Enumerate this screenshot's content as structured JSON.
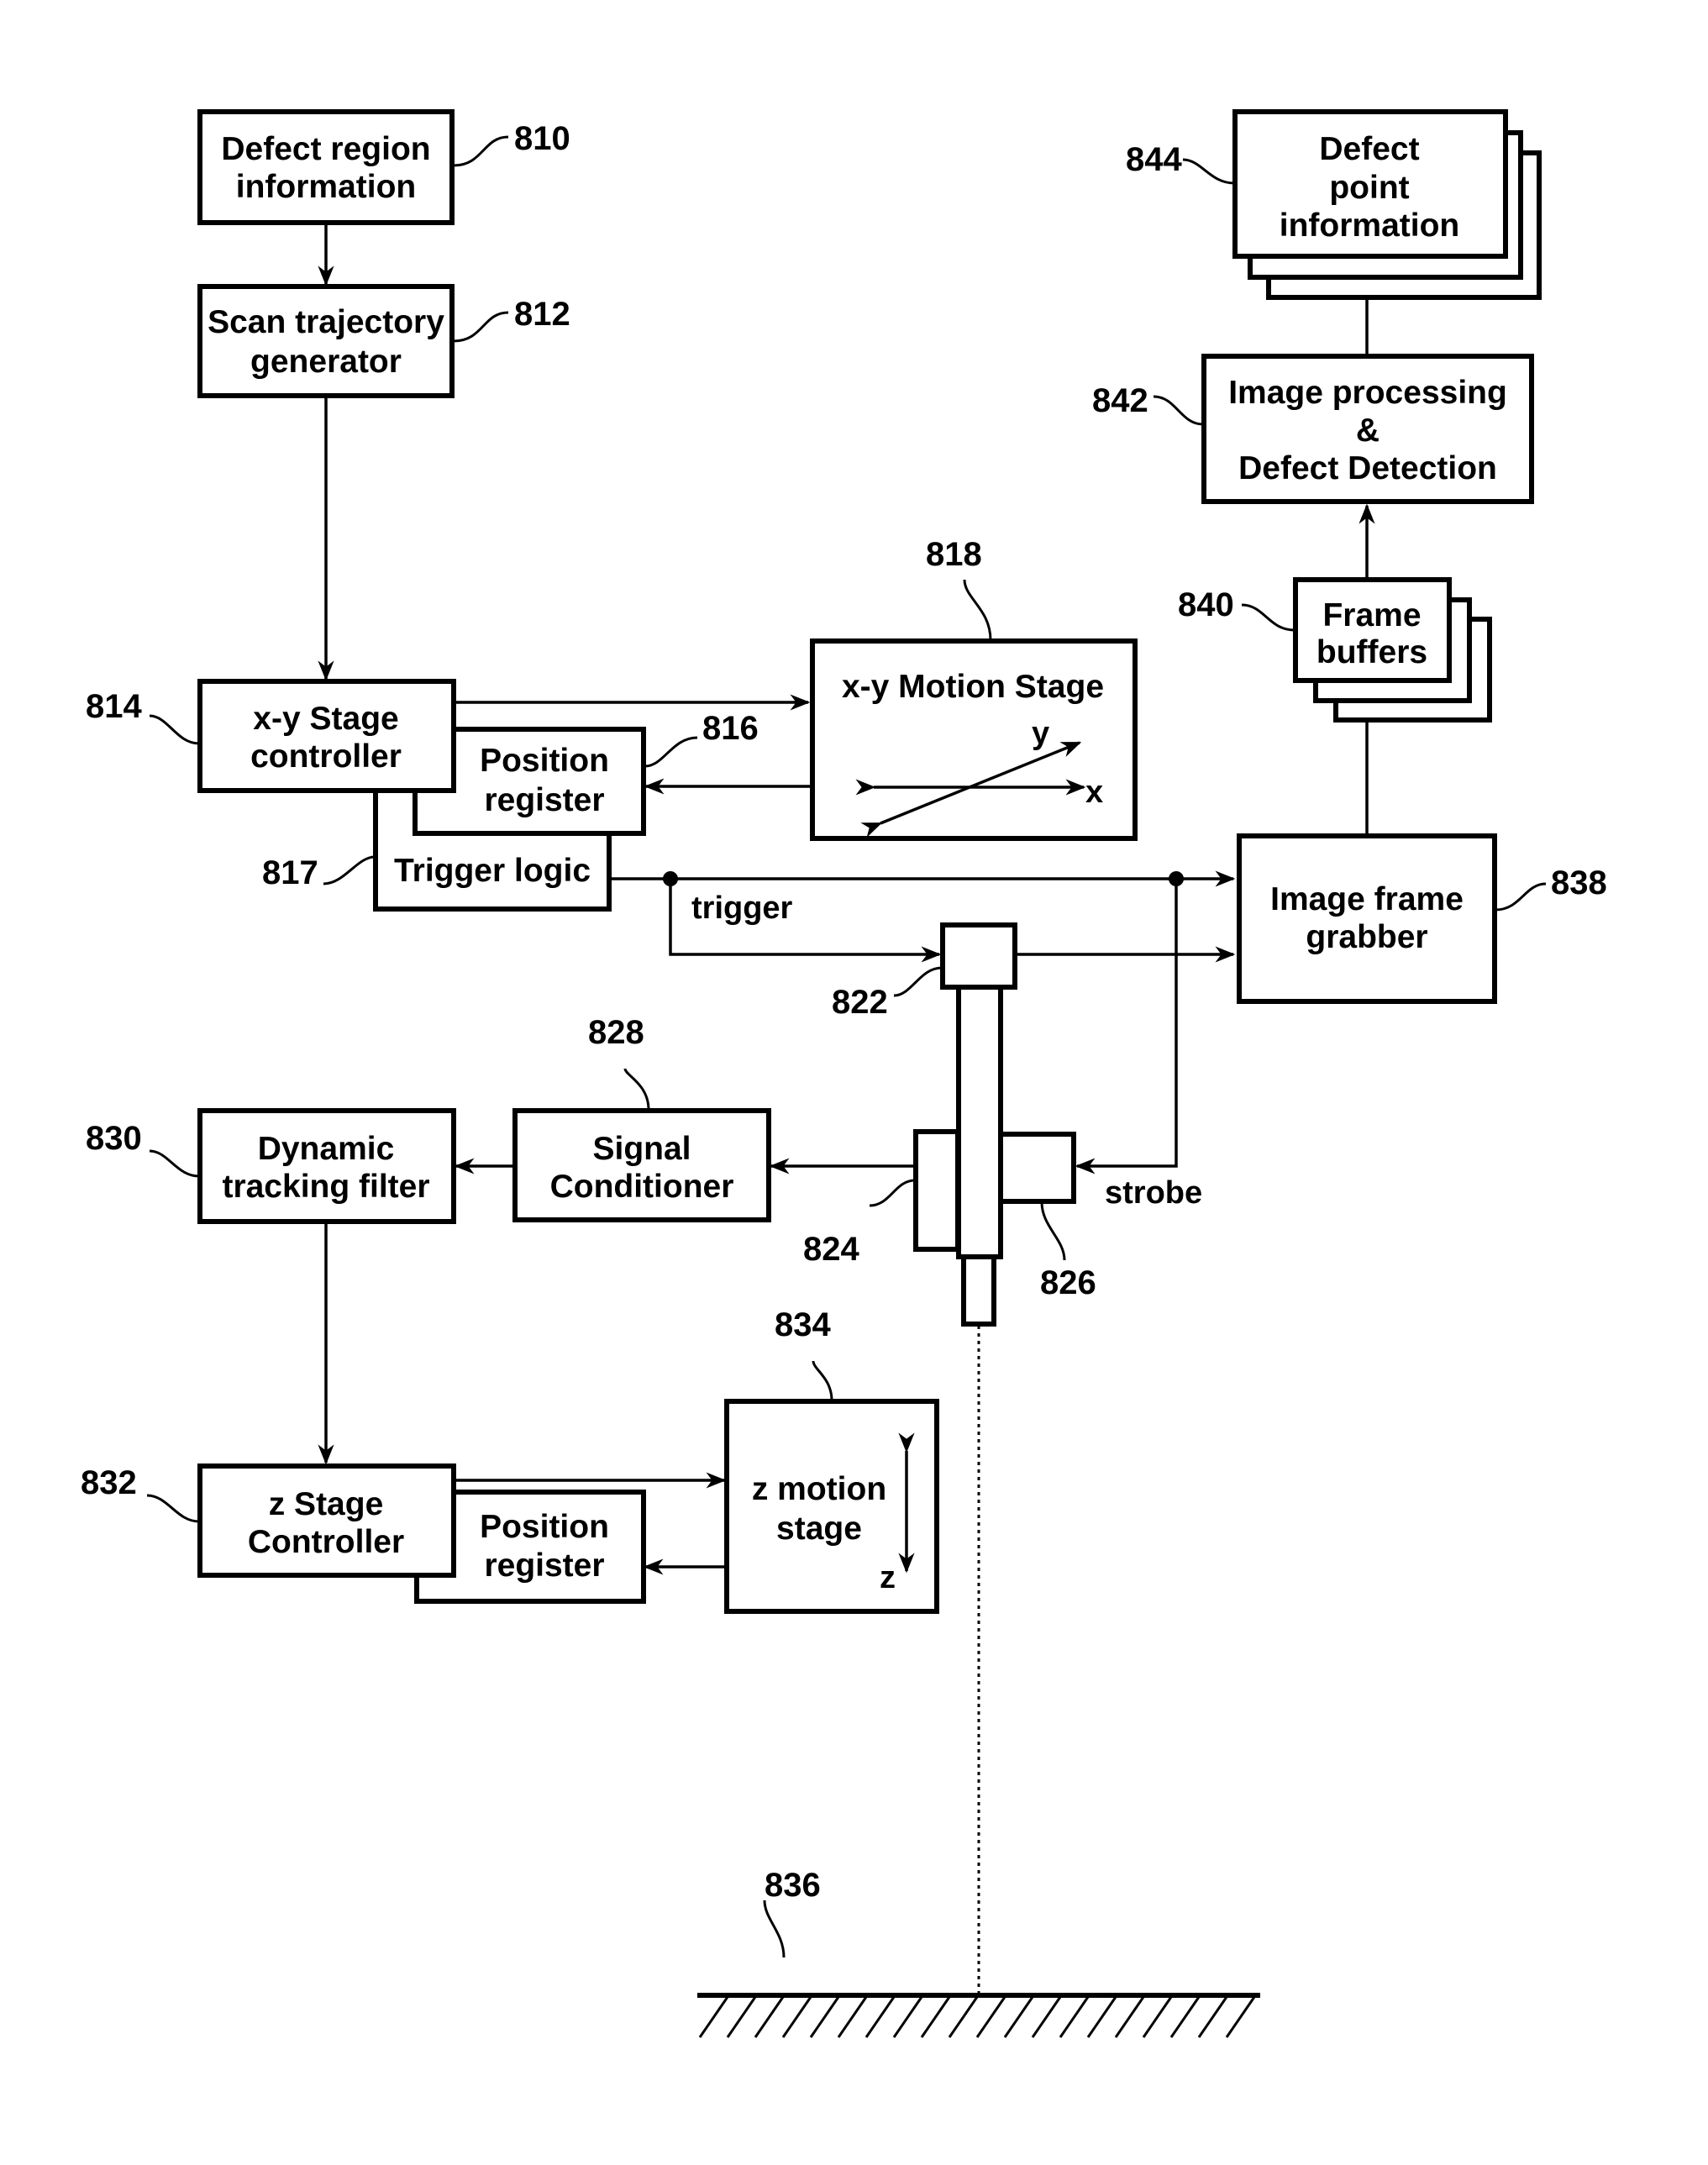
{
  "blocks": {
    "defect_region_info": {
      "ref": "810",
      "lines": [
        "Defect region",
        "information"
      ]
    },
    "scan_trajectory": {
      "ref": "812",
      "lines": [
        "Scan trajectory",
        "generator"
      ]
    },
    "xy_stage_controller": {
      "ref": "814",
      "lines": [
        "x-y Stage",
        "controller"
      ]
    },
    "xy_position_register": {
      "ref": "816",
      "lines": [
        "Position",
        "register"
      ]
    },
    "trigger_logic": {
      "ref": "817",
      "lines": [
        "Trigger logic"
      ]
    },
    "xy_motion_stage": {
      "ref": "818",
      "lines": [
        "x-y Motion Stage"
      ],
      "axis_x": "x",
      "axis_y": "y"
    },
    "sensor_head": {
      "ref": "822"
    },
    "sensor_left": {
      "ref": "824"
    },
    "sensor_right": {
      "ref": "826"
    },
    "signal_conditioner": {
      "ref": "828",
      "lines": [
        "Signal",
        "Conditioner"
      ]
    },
    "dynamic_tracking_filter": {
      "ref": "830",
      "lines": [
        "Dynamic",
        "tracking filter"
      ]
    },
    "z_stage_controller": {
      "ref": "832",
      "lines": [
        "z Stage",
        "Controller"
      ]
    },
    "z_position_register": {
      "lines": [
        "Position",
        "register"
      ]
    },
    "z_motion_stage": {
      "ref": "834",
      "lines": [
        "z motion",
        "stage"
      ],
      "axis_z": "z"
    },
    "surface": {
      "ref": "836"
    },
    "image_frame_grabber": {
      "ref": "838",
      "lines": [
        "Image frame",
        "grabber"
      ]
    },
    "frame_buffers": {
      "ref": "840",
      "lines": [
        "Frame",
        "buffers"
      ]
    },
    "image_processing": {
      "ref": "842",
      "lines": [
        "Image processing",
        "&",
        "Defect Detection"
      ]
    },
    "defect_point_info": {
      "ref": "844",
      "lines": [
        "Defect",
        "point",
        "information"
      ]
    }
  },
  "signals": {
    "trigger": "trigger",
    "strobe": "strobe"
  }
}
